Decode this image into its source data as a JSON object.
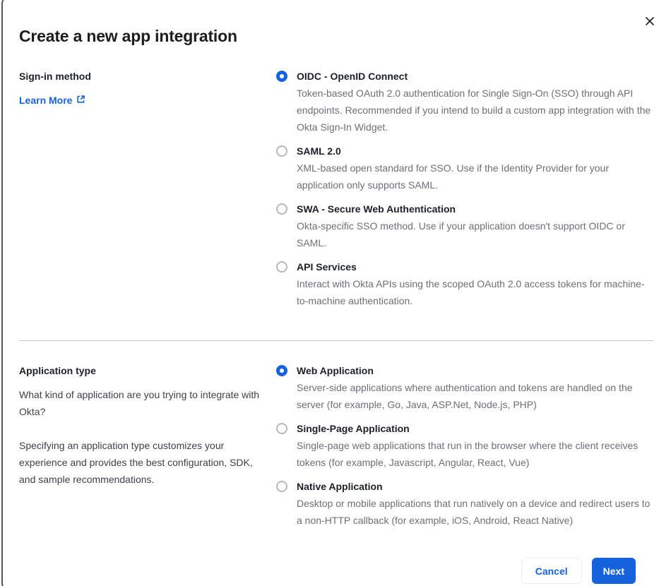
{
  "modal": {
    "title": "Create a new app integration"
  },
  "signin": {
    "heading": "Sign-in method",
    "learn_more_label": "Learn More",
    "options": [
      {
        "label": "OIDC - OpenID Connect",
        "description": "Token-based OAuth 2.0 authentication for Single Sign-On (SSO) through API endpoints. Recommended if you intend to build a custom app integration with the Okta Sign-In Widget.",
        "selected": true
      },
      {
        "label": "SAML 2.0",
        "description": "XML-based open standard for SSO. Use if the Identity Provider for your application only supports SAML.",
        "selected": false
      },
      {
        "label": "SWA - Secure Web Authentication",
        "description": "Okta-specific SSO method. Use if your application doesn't support OIDC or SAML.",
        "selected": false
      },
      {
        "label": "API Services",
        "description": "Interact with Okta APIs using the scoped OAuth 2.0 access tokens for machine-to-machine authentication.",
        "selected": false
      }
    ]
  },
  "apptype": {
    "heading": "Application type",
    "paragraph1": "What kind of application are you trying to integrate with Okta?",
    "paragraph2": "Specifying an application type customizes your experience and provides the best configuration, SDK, and sample recommendations.",
    "options": [
      {
        "label": "Web Application",
        "description": "Server-side applications where authentication and tokens are handled on the server (for example, Go, Java, ASP.Net, Node.js, PHP)",
        "selected": true
      },
      {
        "label": "Single-Page Application",
        "description": "Single-page web applications that run in the browser where the client receives tokens (for example, Javascript, Angular, React, Vue)",
        "selected": false
      },
      {
        "label": "Native Application",
        "description": "Desktop or mobile applications that run natively on a device and redirect users to a non-HTTP callback (for example, iOS, Android, React Native)",
        "selected": false
      }
    ]
  },
  "footer": {
    "cancel_label": "Cancel",
    "next_label": "Next"
  },
  "colors": {
    "accent": "#1662dd",
    "heading_text": "#1d1d21",
    "body_text": "#272833",
    "muted_text": "#6e6e78",
    "divider": "#c9c9ce",
    "radio_border": "#b7b7bd",
    "modal_border": "#54545c"
  }
}
